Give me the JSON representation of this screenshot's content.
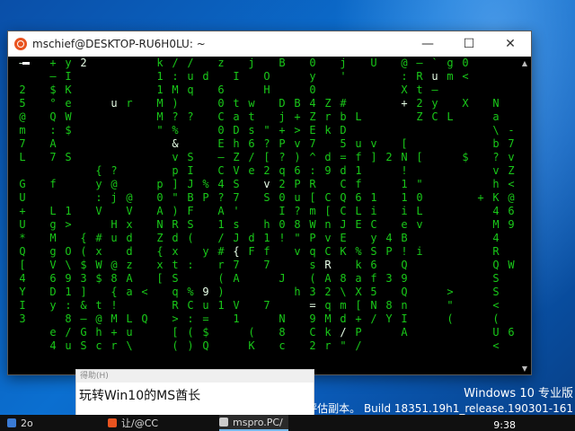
{
  "window": {
    "title": "mschief@DESKTOP-RU6H0LU: ~",
    "controls": {
      "minimize": "—",
      "maximize": "☐",
      "close": "✕"
    }
  },
  "terminal": {
    "columns": [
      [
        "–",
        "",
        "2",
        "5",
        "@",
        "m",
        "7",
        "L",
        "",
        "G",
        "U",
        "+",
        "U",
        "*",
        "Q",
        "[",
        "4",
        "Y",
        "I",
        "3",
        "",
        ""
      ],
      [
        "",
        "",
        "",
        "",
        "",
        "",
        "",
        "",
        "",
        "",
        "",
        "",
        "",
        "",
        "",
        "",
        "",
        "",
        "",
        "",
        "",
        ""
      ],
      [
        "+",
        "–",
        "$",
        "°",
        "Q",
        ":",
        "A",
        "7",
        "",
        "f",
        "",
        "L",
        "g",
        "M",
        "g",
        "V",
        "6",
        "D",
        "y",
        "",
        "e",
        "4"
      ],
      [
        "y",
        "I",
        "K",
        "e",
        "W",
        "$",
        "",
        "S",
        "",
        "",
        "",
        "1",
        ">",
        "",
        "O",
        "\\",
        "9",
        "1",
        ":",
        "8",
        "/",
        "u"
      ],
      [
        "2",
        "",
        "",
        "",
        "",
        "",
        "",
        "",
        "",
        "",
        "",
        "",
        "",
        "{",
        "(",
        "$",
        "3",
        "]",
        "&",
        "–",
        "G",
        "S"
      ],
      [
        "",
        "",
        "",
        "",
        "",
        "",
        "",
        "",
        "{",
        "y",
        ":",
        "V",
        "",
        "#",
        "x",
        "W",
        "$",
        "",
        "t",
        "@",
        "h",
        "c"
      ],
      [
        "",
        "",
        "",
        "u",
        "",
        "",
        "",
        "",
        "?",
        "@",
        "j",
        "",
        "H",
        "u",
        "",
        "@",
        "8",
        "{",
        "!",
        "M",
        "+",
        "r"
      ],
      [
        "",
        "",
        "",
        "r",
        "",
        "",
        "",
        "",
        "",
        "",
        "@",
        "V",
        "x",
        "d",
        "d",
        "z",
        "A",
        "a",
        "",
        "L",
        "u",
        "\\"
      ],
      [
        "",
        "",
        "",
        "",
        "",
        "",
        "",
        "",
        "",
        "",
        "",
        "",
        "",
        "",
        "",
        "",
        "",
        "<",
        "",
        "Q",
        "",
        ""
      ],
      [
        "k",
        "1",
        "1",
        "M",
        "M",
        "\"",
        "",
        "",
        "",
        "p",
        "0",
        "A",
        "N",
        "Z",
        "{",
        "x",
        "[",
        "",
        "",
        "",
        "",
        ""
      ],
      [
        "/",
        ":",
        "M",
        ")",
        "?",
        "%",
        "&",
        "v",
        "p",
        "]",
        "\"",
        ")",
        "R",
        "d",
        "x",
        "t",
        "S",
        "q",
        "R",
        ">",
        "[",
        "("
      ],
      [
        "/",
        "u",
        "q",
        "",
        "?",
        "",
        "",
        "S",
        "I",
        "J",
        "B",
        "F",
        "S",
        "(",
        "",
        ":",
        "",
        "%",
        "C",
        ":",
        "(",
        ")"
      ],
      [
        "",
        "d",
        "",
        "",
        "",
        "",
        "",
        "",
        "",
        "%",
        "P",
        "",
        "",
        "",
        "y",
        "",
        "",
        "9",
        "u",
        "=",
        "$",
        "Q"
      ],
      [
        "z",
        "",
        "6",
        "0",
        "C",
        "0",
        "E",
        "–",
        "C",
        "4",
        "?",
        "A",
        "1",
        "/",
        "#",
        "r",
        "(",
        ")",
        "1",
        "",
        "",
        ""
      ],
      [
        "",
        "I",
        "",
        "t",
        "a",
        "D",
        "h",
        "Z",
        "V",
        "S",
        "7",
        "'",
        "s",
        "J",
        "{",
        "7",
        "A",
        "",
        "V",
        "1",
        "",
        ""
      ],
      [
        "j",
        "",
        "",
        "w",
        "t",
        "s",
        "6",
        "/",
        "e",
        "",
        "",
        "",
        "",
        "d",
        "F",
        "",
        "",
        "",
        "",
        "",
        "(",
        "K"
      ],
      [
        "",
        "O",
        "H",
        "",
        "",
        "\"",
        "?",
        "[",
        "2",
        "v",
        "S",
        "",
        "h",
        "1",
        "f",
        "7",
        "",
        "",
        "7",
        "",
        "",
        ""
      ],
      [
        "B",
        "",
        "",
        "D",
        "j",
        "+",
        "P",
        "?",
        "q",
        "2",
        "0",
        "I",
        "0",
        "!",
        "",
        "",
        "J",
        "",
        "",
        "N",
        "8",
        "c"
      ],
      [
        "",
        "",
        "",
        "B",
        "+",
        ">",
        "v",
        ")",
        "6",
        "P",
        "u",
        "?",
        "8",
        "\"",
        "v",
        "",
        "",
        "h",
        "",
        "",
        "",
        ""
      ],
      [
        "0",
        "y",
        "0",
        "4",
        "Z",
        "E",
        "7",
        "^",
        ":",
        "R",
        "[",
        "m",
        "W",
        "P",
        "q",
        "s",
        "(",
        "3",
        "=",
        "9",
        "C",
        "2"
      ],
      [
        "",
        "",
        "",
        "Z",
        "r",
        "k",
        "",
        "d",
        "9",
        "",
        "C",
        "[",
        "n",
        "v",
        "C",
        "R",
        "A",
        "2",
        "q",
        "M",
        "k",
        "r"
      ],
      [
        "j",
        "'",
        "",
        "#",
        "b",
        "D",
        "5",
        "=",
        "d",
        "C",
        "Q",
        "C",
        "J",
        "E",
        "K",
        "",
        "8",
        "\\",
        "m",
        "d",
        "/",
        "\""
      ],
      [
        "",
        "",
        "",
        "",
        "L",
        "",
        "u",
        "f",
        "1",
        "f",
        "6",
        "L",
        "E",
        "",
        "%",
        "k",
        "a",
        "X",
        "[",
        "+",
        "P",
        "/"
      ],
      [
        "U",
        "",
        "",
        "",
        "",
        "",
        "v",
        "]",
        "",
        "",
        "1",
        "i",
        "C",
        "y",
        "S",
        "6",
        "f",
        "5",
        "N",
        "/",
        "",
        ""
      ],
      [
        "",
        "",
        "",
        "",
        "",
        "",
        "",
        "2",
        "",
        "",
        "",
        "",
        "",
        "4",
        "P",
        "",
        "3",
        "",
        "8",
        "Y",
        "",
        ""
      ],
      [
        "@",
        ":",
        "X",
        "+",
        "",
        "",
        "[",
        "N",
        "!",
        "1",
        "1",
        "i",
        "e",
        "B",
        "!",
        "Q",
        "9",
        "Q",
        "n",
        "I",
        "A",
        ""
      ],
      [
        "–",
        "R",
        "t",
        "2",
        "Z",
        "",
        "",
        "[",
        "",
        "\"",
        "0",
        "L",
        "v",
        "",
        "i",
        "",
        "",
        "",
        "",
        "",
        "",
        ""
      ],
      [
        "`",
        "u",
        "–",
        "y",
        "C",
        "",
        "",
        "",
        "",
        "",
        "",
        "",
        "",
        "",
        "",
        "",
        "",
        "",
        "",
        "",
        "",
        ""
      ],
      [
        "g",
        "m",
        "",
        "",
        "L",
        "",
        "",
        "",
        "",
        "",
        "",
        "",
        "",
        "",
        "",
        "",
        "",
        ">",
        "\"",
        "(",
        "",
        ""
      ],
      [
        "0",
        "<",
        "",
        "X",
        "",
        "",
        "",
        "$",
        "",
        "",
        "",
        "",
        "",
        "",
        "",
        "",
        "",
        "",
        "",
        "",
        "",
        ""
      ],
      [
        "",
        "",
        "",
        "",
        "",
        "",
        "",
        "",
        "",
        "",
        "+",
        "",
        "",
        "",
        "",
        "",
        "",
        "",
        "",
        "",
        "",
        ""
      ],
      [
        "",
        "",
        "",
        "N",
        "a",
        "\\",
        "b",
        "?",
        "v",
        "h",
        "K",
        "4",
        "M",
        "4",
        "R",
        "Q",
        "S",
        "S",
        "<",
        "(",
        "U",
        "<"
      ],
      [
        "",
        "",
        "",
        "",
        "",
        "-",
        "7",
        "v",
        "Z",
        "<",
        "@",
        "6",
        "9",
        "",
        "",
        "W",
        "",
        "",
        "",
        "",
        "6",
        ""
      ]
    ],
    "highlights": [
      {
        "col": 0,
        "row": 0
      },
      {
        "col": 4,
        "row": 0
      },
      {
        "col": 6,
        "row": 3
      },
      {
        "col": 10,
        "row": 6
      },
      {
        "col": 15,
        "row": 1
      },
      {
        "col": 16,
        "row": 9
      },
      {
        "col": 14,
        "row": 14
      },
      {
        "col": 17,
        "row": 14
      },
      {
        "col": 20,
        "row": 15
      },
      {
        "col": 19,
        "row": 18
      },
      {
        "col": 23,
        "row": 20
      },
      {
        "col": 25,
        "row": 3
      },
      {
        "col": 27,
        "row": 1
      },
      {
        "col": 29,
        "row": 15
      },
      {
        "col": 32,
        "row": 16
      },
      {
        "col": 1,
        "row": 17
      },
      {
        "col": 7,
        "row": 18
      },
      {
        "col": 12,
        "row": 17
      },
      {
        "col": 21,
        "row": 20
      },
      {
        "col": 18,
        "row": 21
      }
    ]
  },
  "popup": {
    "header": "得助(H)",
    "text": "玩转Win10的MS酋长"
  },
  "watermark": {
    "line1": "Windows 10 专业版",
    "line2": "评估副本。 Build 18351.19h1_release.190301-161"
  },
  "taskbar": {
    "items": [
      "2o",
      "让/@CC",
      "mspro.PC/"
    ],
    "clock": "9:38"
  },
  "colors": {
    "matrix_green": "#19c819",
    "highlight": "#e8ffe8",
    "ubuntu_orange": "#e95420"
  }
}
